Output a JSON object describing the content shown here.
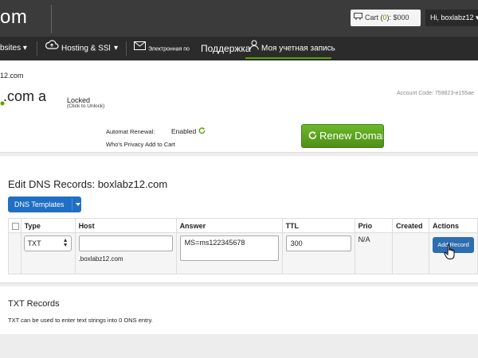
{
  "header": {
    "logo_text": "om",
    "cart_label": "Cart (",
    "cart_count": "0",
    "cart_close": "):",
    "cart_amount": "$000",
    "greeting": "Hi, boxlabz12 ▾"
  },
  "nav": {
    "websites": "bsites ▾",
    "hosting": "Hosting & SSl",
    "hosting_caret": "▾",
    "email": "Электронная по",
    "support": "Поддержка",
    "account": "Моя учетная запись"
  },
  "domain": {
    "breadcrumb": "12.com",
    "name_part": ".com a",
    "lock_status": "Locked",
    "lock_hint": "(Click to Unlock)",
    "account_code": "Account Code: 759823-e155ae",
    "renewal_label": "Automat Renewal:",
    "renewal_value": "Enabled",
    "privacy_text": "Who's Privacy Add to Cart",
    "renew_button": "Renew Domain"
  },
  "dns": {
    "title": "Edit DNS Records: boxlabz12.com",
    "templates_button": "DNS Templates",
    "columns": [
      "Type",
      "Host",
      "Answer",
      "TTL",
      "Prio",
      "Created",
      "Actions"
    ],
    "row": {
      "type": "TXT",
      "host_value": "",
      "host_suffix": ".boxlabz12.com",
      "answer": "MS=ms122345678",
      "ttl": "300",
      "prio": "N/A",
      "created": "",
      "action": "Add Record"
    }
  },
  "txt": {
    "title": "TXT Records",
    "description": "TXT can be used to enter text strings into 0 ONS entry."
  },
  "colors": {
    "accent_green": "#5aa000",
    "primary_blue": "#1f6fc4",
    "header_bg": "#3b3b3b",
    "nav_bg": "#2b2b2b"
  }
}
